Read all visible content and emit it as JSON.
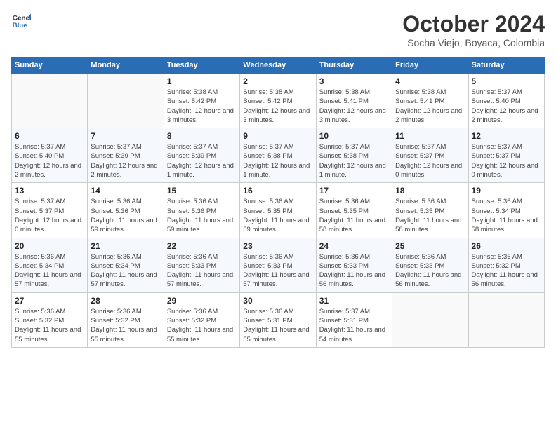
{
  "logo": {
    "line1": "General",
    "line2": "Blue"
  },
  "title": "October 2024",
  "location": "Socha Viejo, Boyaca, Colombia",
  "weekdays": [
    "Sunday",
    "Monday",
    "Tuesday",
    "Wednesday",
    "Thursday",
    "Friday",
    "Saturday"
  ],
  "weeks": [
    [
      {
        "day": "",
        "info": ""
      },
      {
        "day": "",
        "info": ""
      },
      {
        "day": "1",
        "info": "Sunrise: 5:38 AM\nSunset: 5:42 PM\nDaylight: 12 hours and 3 minutes."
      },
      {
        "day": "2",
        "info": "Sunrise: 5:38 AM\nSunset: 5:42 PM\nDaylight: 12 hours and 3 minutes."
      },
      {
        "day": "3",
        "info": "Sunrise: 5:38 AM\nSunset: 5:41 PM\nDaylight: 12 hours and 3 minutes."
      },
      {
        "day": "4",
        "info": "Sunrise: 5:38 AM\nSunset: 5:41 PM\nDaylight: 12 hours and 2 minutes."
      },
      {
        "day": "5",
        "info": "Sunrise: 5:37 AM\nSunset: 5:40 PM\nDaylight: 12 hours and 2 minutes."
      }
    ],
    [
      {
        "day": "6",
        "info": "Sunrise: 5:37 AM\nSunset: 5:40 PM\nDaylight: 12 hours and 2 minutes."
      },
      {
        "day": "7",
        "info": "Sunrise: 5:37 AM\nSunset: 5:39 PM\nDaylight: 12 hours and 2 minutes."
      },
      {
        "day": "8",
        "info": "Sunrise: 5:37 AM\nSunset: 5:39 PM\nDaylight: 12 hours and 1 minute."
      },
      {
        "day": "9",
        "info": "Sunrise: 5:37 AM\nSunset: 5:38 PM\nDaylight: 12 hours and 1 minute."
      },
      {
        "day": "10",
        "info": "Sunrise: 5:37 AM\nSunset: 5:38 PM\nDaylight: 12 hours and 1 minute."
      },
      {
        "day": "11",
        "info": "Sunrise: 5:37 AM\nSunset: 5:37 PM\nDaylight: 12 hours and 0 minutes."
      },
      {
        "day": "12",
        "info": "Sunrise: 5:37 AM\nSunset: 5:37 PM\nDaylight: 12 hours and 0 minutes."
      }
    ],
    [
      {
        "day": "13",
        "info": "Sunrise: 5:37 AM\nSunset: 5:37 PM\nDaylight: 12 hours and 0 minutes."
      },
      {
        "day": "14",
        "info": "Sunrise: 5:36 AM\nSunset: 5:36 PM\nDaylight: 11 hours and 59 minutes."
      },
      {
        "day": "15",
        "info": "Sunrise: 5:36 AM\nSunset: 5:36 PM\nDaylight: 11 hours and 59 minutes."
      },
      {
        "day": "16",
        "info": "Sunrise: 5:36 AM\nSunset: 5:35 PM\nDaylight: 11 hours and 59 minutes."
      },
      {
        "day": "17",
        "info": "Sunrise: 5:36 AM\nSunset: 5:35 PM\nDaylight: 11 hours and 58 minutes."
      },
      {
        "day": "18",
        "info": "Sunrise: 5:36 AM\nSunset: 5:35 PM\nDaylight: 11 hours and 58 minutes."
      },
      {
        "day": "19",
        "info": "Sunrise: 5:36 AM\nSunset: 5:34 PM\nDaylight: 11 hours and 58 minutes."
      }
    ],
    [
      {
        "day": "20",
        "info": "Sunrise: 5:36 AM\nSunset: 5:34 PM\nDaylight: 11 hours and 57 minutes."
      },
      {
        "day": "21",
        "info": "Sunrise: 5:36 AM\nSunset: 5:34 PM\nDaylight: 11 hours and 57 minutes."
      },
      {
        "day": "22",
        "info": "Sunrise: 5:36 AM\nSunset: 5:33 PM\nDaylight: 11 hours and 57 minutes."
      },
      {
        "day": "23",
        "info": "Sunrise: 5:36 AM\nSunset: 5:33 PM\nDaylight: 11 hours and 57 minutes."
      },
      {
        "day": "24",
        "info": "Sunrise: 5:36 AM\nSunset: 5:33 PM\nDaylight: 11 hours and 56 minutes."
      },
      {
        "day": "25",
        "info": "Sunrise: 5:36 AM\nSunset: 5:33 PM\nDaylight: 11 hours and 56 minutes."
      },
      {
        "day": "26",
        "info": "Sunrise: 5:36 AM\nSunset: 5:32 PM\nDaylight: 11 hours and 56 minutes."
      }
    ],
    [
      {
        "day": "27",
        "info": "Sunrise: 5:36 AM\nSunset: 5:32 PM\nDaylight: 11 hours and 55 minutes."
      },
      {
        "day": "28",
        "info": "Sunrise: 5:36 AM\nSunset: 5:32 PM\nDaylight: 11 hours and 55 minutes."
      },
      {
        "day": "29",
        "info": "Sunrise: 5:36 AM\nSunset: 5:32 PM\nDaylight: 11 hours and 55 minutes."
      },
      {
        "day": "30",
        "info": "Sunrise: 5:36 AM\nSunset: 5:31 PM\nDaylight: 11 hours and 55 minutes."
      },
      {
        "day": "31",
        "info": "Sunrise: 5:37 AM\nSunset: 5:31 PM\nDaylight: 11 hours and 54 minutes."
      },
      {
        "day": "",
        "info": ""
      },
      {
        "day": "",
        "info": ""
      }
    ]
  ]
}
